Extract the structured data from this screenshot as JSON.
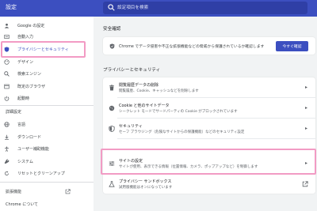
{
  "app": {
    "title": "設定"
  },
  "search": {
    "placeholder": "設定項目を検索"
  },
  "sidebar": {
    "items": [
      {
        "label": "Google の設定"
      },
      {
        "label": "自動入力"
      },
      {
        "label": "プライバシーとセキュリティ"
      },
      {
        "label": "デザイン"
      },
      {
        "label": "検索エンジン"
      },
      {
        "label": "既定のブラウザ"
      },
      {
        "label": "起動時"
      }
    ],
    "advanced_label": "詳細設定",
    "advanced_items": [
      {
        "label": "言語"
      },
      {
        "label": "ダウンロード"
      },
      {
        "label": "ユーザー補助機能"
      },
      {
        "label": "システム"
      },
      {
        "label": "リセットとクリーンアップ"
      }
    ],
    "extensions_label": "拡張機能",
    "about_label": "Chrome について"
  },
  "main": {
    "safety_heading": "安全確認",
    "safety_text": "Chrome でデータ侵害や不正な拡張機能などの脅威から保護されているか確認します",
    "safety_button": "今すぐ確認",
    "privacy_heading": "プライバシーとセキュリティ",
    "privacy_rows": [
      {
        "title": "閲覧履歴データの削除",
        "desc": "閲覧履歴、Cookie、キャッシュなどを削除します"
      },
      {
        "title": "Cookie と他のサイトデータ",
        "desc": "シークレット モードでサードパーティの Cookie がブロックされています"
      },
      {
        "title": "セキュリティ",
        "desc": "セーフ ブラウジング（危険なサイトからの保護機能）などのセキュリティ設定"
      },
      {
        "title": "サイトの設定",
        "desc": "サイトが使用、表示できる情報（位置情報、カメラ、ポップアップなど）を制御します"
      },
      {
        "title": "プライバシー サンドボックス",
        "desc": "試用版機能はオンになっています"
      }
    ]
  },
  "colors": {
    "brand": "#3c4fc0",
    "highlight": "#f29bc4",
    "background": "#f1f3f4"
  },
  "icons": [
    "search-icon",
    "google-icon",
    "autofill-icon",
    "shield-icon",
    "palette-icon",
    "search-engine-icon",
    "browser-icon",
    "power-icon",
    "globe-icon",
    "download-icon",
    "accessibility-icon",
    "wrench-icon",
    "reset-icon",
    "external-link-icon",
    "trash-icon",
    "cookie-icon",
    "security-shield-icon",
    "sliders-icon",
    "flask-icon",
    "chevron-right-icon"
  ]
}
